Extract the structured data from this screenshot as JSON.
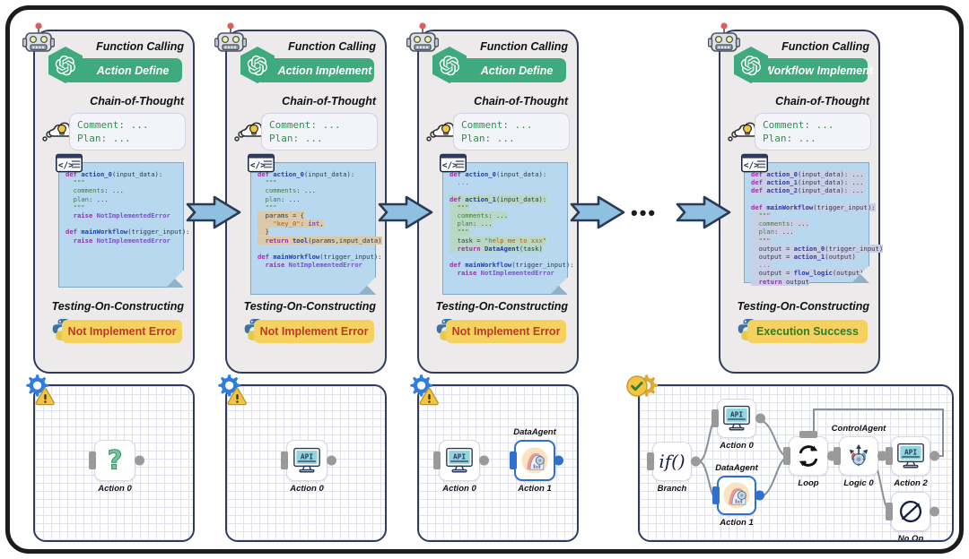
{
  "meta": {
    "colors": {
      "panel_bg": "#eceaea",
      "panel_border": "#2e3b63",
      "accent_green": "#3faa7d",
      "code_bg": "#b8d8ef",
      "status_yellow": "#f5d25f",
      "error_red": "#c0392b",
      "success_green": "#2e7d32",
      "arrow_blue": "#8fc0e0",
      "node_blue": "#2f6fd0"
    }
  },
  "panels": [
    {
      "robot_icon": "robot-icon",
      "function_calling_label": "Function Calling",
      "openai_icon": "openai-icon",
      "action_pill": "Action Define",
      "cot_label": "Chain-of-Thought",
      "bulb_icon": "thought-bulb-icon",
      "cot_line1": "Comment: ...",
      "cot_line2": "Plan: ...",
      "code_icon": "code-file-icon",
      "test_label": "Testing-On-Constructing",
      "python_icon": "python-icon",
      "status": "Not Implement Error",
      "status_kind": "error",
      "gear_icon": "gear-warning-icon",
      "nodes": [
        {
          "label": "Action 0",
          "top_label": "",
          "icon": "question-mark-icon",
          "selected": false
        }
      ]
    },
    {
      "robot_icon": "robot-icon",
      "function_calling_label": "Function Calling",
      "openai_icon": "openai-icon",
      "action_pill": "Action Implement",
      "cot_label": "Chain-of-Thought",
      "bulb_icon": "thought-bulb-icon",
      "cot_line1": "Comment: ...",
      "cot_line2": "Plan: ...",
      "code_icon": "code-file-icon",
      "test_label": "Testing-On-Constructing",
      "python_icon": "python-icon",
      "status": "Not Implement Error",
      "status_kind": "error",
      "gear_icon": "gear-warning-icon",
      "nodes": [
        {
          "label": "Action 0",
          "top_label": "",
          "icon": "api-monitor-icon",
          "selected": false
        }
      ]
    },
    {
      "robot_icon": "robot-icon",
      "function_calling_label": "Function Calling",
      "openai_icon": "openai-icon",
      "action_pill": "Action Define",
      "cot_label": "Chain-of-Thought",
      "bulb_icon": "thought-bulb-icon",
      "cot_line1": "Comment: ...",
      "cot_line2": "Plan: ...",
      "code_icon": "code-file-icon",
      "test_label": "Testing-On-Constructing",
      "python_icon": "python-icon",
      "status": "Not Implement Error",
      "status_kind": "error",
      "gear_icon": "gear-warning-icon",
      "nodes": [
        {
          "label": "Action 0",
          "top_label": "",
          "icon": "api-monitor-icon",
          "selected": false
        },
        {
          "label": "Action 1",
          "top_label": "DataAgent",
          "icon": "data-agent-icon",
          "selected": true
        }
      ]
    },
    {
      "robot_icon": "robot-icon",
      "function_calling_label": "Function Calling",
      "openai_icon": "openai-icon",
      "action_pill": "Workflow Implement",
      "cot_label": "Chain-of-Thought",
      "bulb_icon": "thought-bulb-icon",
      "cot_line1": "Comment: ...",
      "cot_line2": "Plan: ...",
      "code_icon": "code-file-icon",
      "test_label": "Testing-On-Constructing",
      "python_icon": "python-icon",
      "status": "Execution Success",
      "status_kind": "success",
      "gear_icon": "gear-check-icon",
      "nodes": [
        {
          "label": "Branch",
          "top_label": "",
          "icon": "if-branch-icon",
          "selected": false
        },
        {
          "label": "Action 0",
          "top_label": "",
          "icon": "api-monitor-icon",
          "selected": false
        },
        {
          "label": "Action 1",
          "top_label": "DataAgent",
          "icon": "data-agent-icon",
          "selected": true
        },
        {
          "label": "Loop",
          "top_label": "",
          "icon": "loop-icon",
          "selected": false
        },
        {
          "label": "Logic 0",
          "top_label": "ControlAgent",
          "icon": "control-agent-icon",
          "selected": false
        },
        {
          "label": "Action 2",
          "top_label": "",
          "icon": "api-monitor-icon",
          "selected": false
        },
        {
          "label": "No Op",
          "top_label": "",
          "icon": "no-op-icon",
          "selected": false
        }
      ]
    }
  ],
  "code_blocks": {
    "panel1": [
      {
        "t": "def ",
        "c": "kw"
      },
      {
        "t": "action_0",
        "c": "fn"
      },
      {
        "t": "(input_data):",
        "c": "plain"
      },
      {
        "t": "\n",
        "c": "plain"
      },
      {
        "t": "  \"\"\"\n",
        "c": "cm"
      },
      {
        "t": "  comments: ...\n  plan: ...\n  \"\"\"\n",
        "c": "cm"
      },
      {
        "t": "  raise ",
        "c": "kw"
      },
      {
        "t": "NotImplementedError\n\n",
        "c": "bi"
      },
      {
        "t": "def ",
        "c": "kw"
      },
      {
        "t": "mainWorkflow",
        "c": "fn"
      },
      {
        "t": "(trigger_input):\n",
        "c": "plain"
      },
      {
        "t": "  raise ",
        "c": "kw"
      },
      {
        "t": "NotImplementedError",
        "c": "bi"
      }
    ],
    "panel2_lines": [
      "def action_0(input_data):",
      "  \"\"\"",
      "  comments: ...",
      "  plan: ...",
      "  \"\"\"",
      "  params = {",
      "    \"key_0\": int,",
      "  }",
      "  return tool(params,input_data)",
      "",
      "def mainWorkflow(trigger_input):",
      "  raise NotImplementedError"
    ],
    "panel3_lines": [
      "def action_0(input_data):",
      "  ...",
      "",
      "def action_1(input_data):",
      "  \"\"\"",
      "  comments: ...",
      "  plan: ...",
      "  \"\"\"",
      "  task = \"help me to xxx\"",
      "  return DataAgent(task)",
      "",
      "def mainWorkflow(trigger_input):",
      "  raise NotImplementedError"
    ],
    "panel4_lines": [
      "def action_0(input_data): ...",
      "def action_1(input_data): ...",
      "def action_2(input_data): ...",
      "",
      "def mainWorkflow(trigger_input):",
      "  \"\"\"",
      "  comments: ...",
      "  plan: ...",
      "  \"\"\"",
      "  output = action_0(trigger_input)",
      "  output = action_1(output)",
      "  ...",
      "  output = flow_logic(output)",
      "  return output"
    ]
  },
  "flow": {
    "arrow_icon": "right-arrow",
    "ellipsis": "•••"
  }
}
